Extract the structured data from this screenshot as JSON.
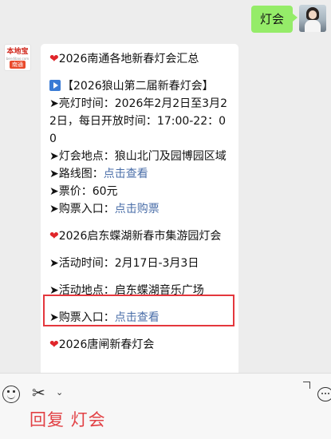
{
  "outgoing_message": {
    "text": "灯会"
  },
  "incoming_avatar": {
    "brand": "本地宝",
    "subtitle": "bendibao.com",
    "city": "南通"
  },
  "incoming_message": {
    "sec1_title": "2026南通各地新春灯会汇总",
    "sec1_heart": "❤",
    "event1_title": "【2026狼山第二届新春灯会】",
    "event1_time": "➤亮灯时间：2026年2月2日至3月22日，每日开放时间：17:00-22：00",
    "event1_place": "➤灯会地点：狼山北门及园博园区域",
    "event1_map_label": "➤路线图：",
    "event1_map_link": "点击查看",
    "event1_price": "➤票价：60元",
    "event1_ticket_label": "➤购票入口：",
    "event1_ticket_link": "点击购票",
    "sec2_heart": "❤",
    "sec2_title": "2026启东蝶湖新春市集游园灯会",
    "event2_time": "➤活动时间：2月17日-3月3日",
    "event2_place": "➤活动地点：启东蝶湖音乐广场",
    "event2_ticket_label": "➤购票入口：",
    "event2_ticket_link": "点击查看",
    "sec3_heart": "❤",
    "sec3_title": "2026唐闸新春灯会"
  },
  "toolbar": {
    "emoji_icon": "emoji-icon",
    "scissors_icon": "✂",
    "chevron_icon": "⌄",
    "chat_icon": "chat-bubble-icon"
  },
  "reply_hint": "回复 灯会",
  "colors": {
    "accent_green": "#95ec69",
    "link_blue": "#4a6ea8",
    "highlight_red": "#e4373d",
    "hint_red": "#e24145"
  }
}
